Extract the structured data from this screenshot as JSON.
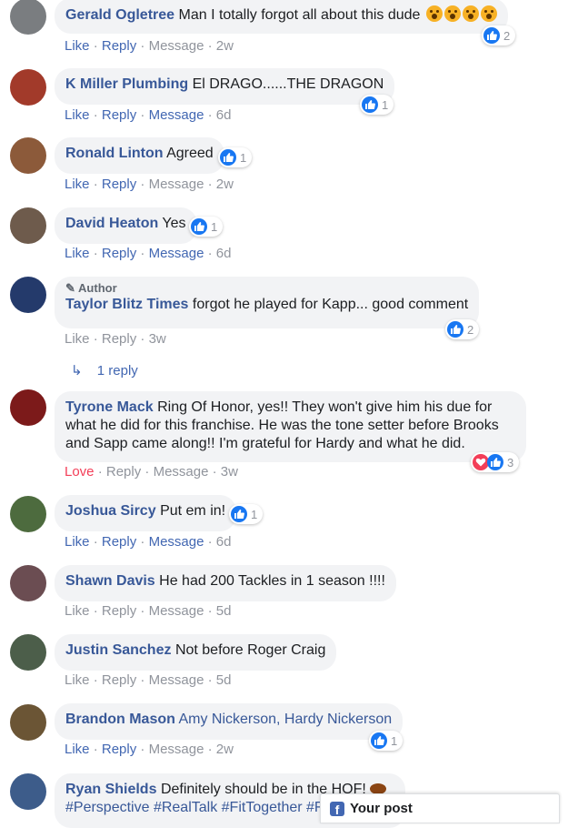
{
  "comments": [
    {
      "name": "Gerald Ogletree",
      "text": "Man I totally forgot all about this dude",
      "like": "Like",
      "reply": "Reply",
      "message": "Message",
      "time": "2w",
      "count": "2",
      "avatar": "#7a7d80"
    },
    {
      "name": "K Miller Plumbing",
      "text": "El DRAGO......THE DRAGON",
      "like": "Like",
      "reply": "Reply",
      "message": "Message",
      "time": "6d",
      "count": "1",
      "avatar": "#a23a2a"
    },
    {
      "name": "Ronald Linton",
      "text": "Agreed",
      "like": "Like",
      "reply": "Reply",
      "message": "Message",
      "time": "2w",
      "count": "1",
      "avatar": "#8c5a3a"
    },
    {
      "name": "David Heaton",
      "text": "Yes",
      "like": "Like",
      "reply": "Reply",
      "message": "Message",
      "time": "6d",
      "count": "1",
      "avatar": "#6e5b4c"
    },
    {
      "badge": "Author",
      "name": "Taylor Blitz Times",
      "text": "forgot he played for Kapp... good comment",
      "like": "Like",
      "reply": "Reply",
      "time": "3w",
      "count": "2",
      "avatar": "#243a6b",
      "replies": "1 reply"
    },
    {
      "name": "Tyrone Mack",
      "text": "Ring Of Honor, yes!! They won't give him his due for what he did for this franchise. He was the tone setter before Brooks and Sapp came along!! I'm grateful for Hardy and what he did.",
      "like": "Love",
      "reply": "Reply",
      "message": "Message",
      "time": "3w",
      "count": "3",
      "avatar": "#7c1a1a"
    },
    {
      "name": "Joshua Sircy",
      "text": "Put em in!",
      "like": "Like",
      "reply": "Reply",
      "message": "Message",
      "time": "6d",
      "count": "1",
      "avatar": "#4d6b3e"
    },
    {
      "name": "Shawn Davis",
      "text": "He had 200 Tackles in 1 season !!!!",
      "like": "Like",
      "reply": "Reply",
      "message": "Message",
      "time": "5d",
      "avatar": "#6b4d52"
    },
    {
      "name": "Justin Sanchez",
      "text": "Not before Roger Craig",
      "like": "Like",
      "reply": "Reply",
      "message": "Message",
      "time": "5d",
      "avatar": "#4c5e4a"
    },
    {
      "name": "Brandon Mason",
      "text": "Amy Nickerson, Hardy Nickerson",
      "like": "Like",
      "reply": "Reply",
      "message": "Message",
      "time": "2w",
      "count": "1",
      "avatar": "#6b5535"
    },
    {
      "name": "Ryan Shields",
      "text": "Definitely should be in the HOF!",
      "tags": "#Perspective #RealTalk #FitTogether #F",
      "avatar": "#3d5c8a"
    }
  ],
  "dock": {
    "label": "Your post"
  }
}
